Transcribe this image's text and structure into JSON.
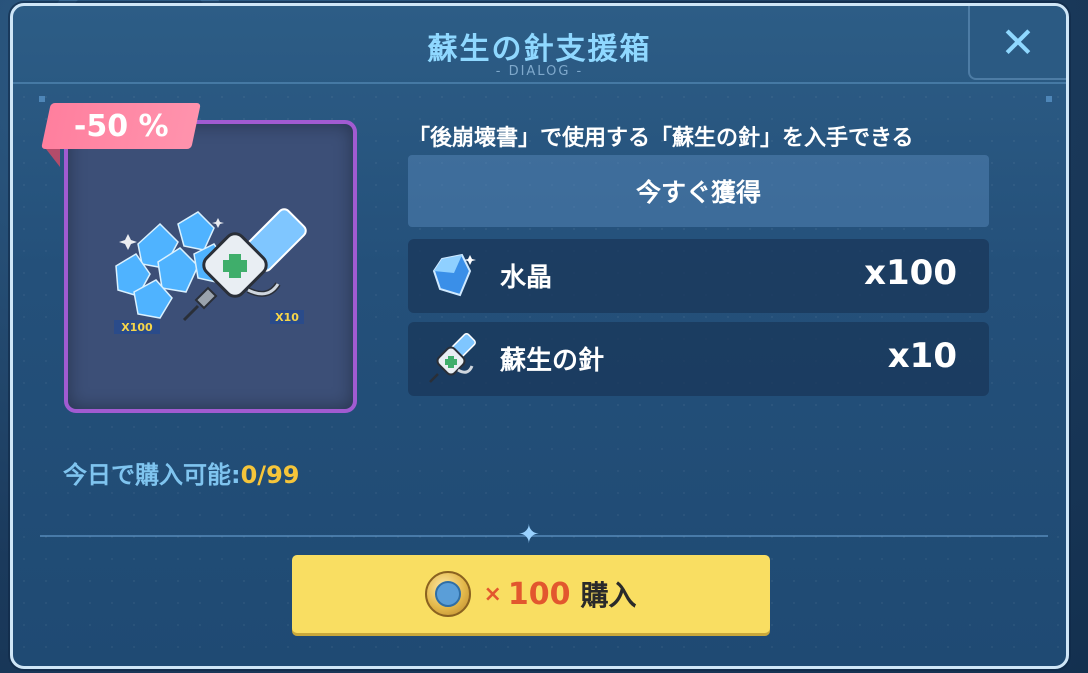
{
  "dialog": {
    "title": "蘇生の針支援箱",
    "subtitle": "- DIALOG -",
    "close_icon": "close-icon"
  },
  "item": {
    "discount": "-50 %",
    "badge_left": "X100",
    "badge_right": "X10"
  },
  "limit": {
    "label": "今日で購入可能:",
    "value": "0/99"
  },
  "description": "「後崩壊書」で使用する「蘇生の針」を入手できる",
  "get_now_label": "今すぐ獲得",
  "rewards": [
    {
      "icon": "crystal-icon",
      "name": "水晶",
      "qty": "x100"
    },
    {
      "icon": "revive-needle-icon",
      "name": "蘇生の針",
      "qty": "x10"
    }
  ],
  "buy": {
    "currency_icon": "coin-icon",
    "times": "×",
    "price": "100",
    "label": "購入"
  },
  "colors": {
    "title": "#8fd8ff",
    "discount": "#ff8aa6",
    "card_border": "#a15bd1",
    "limit_value": "#f5c53a",
    "buy_button": "#f9de62",
    "price": "#e2572e"
  }
}
